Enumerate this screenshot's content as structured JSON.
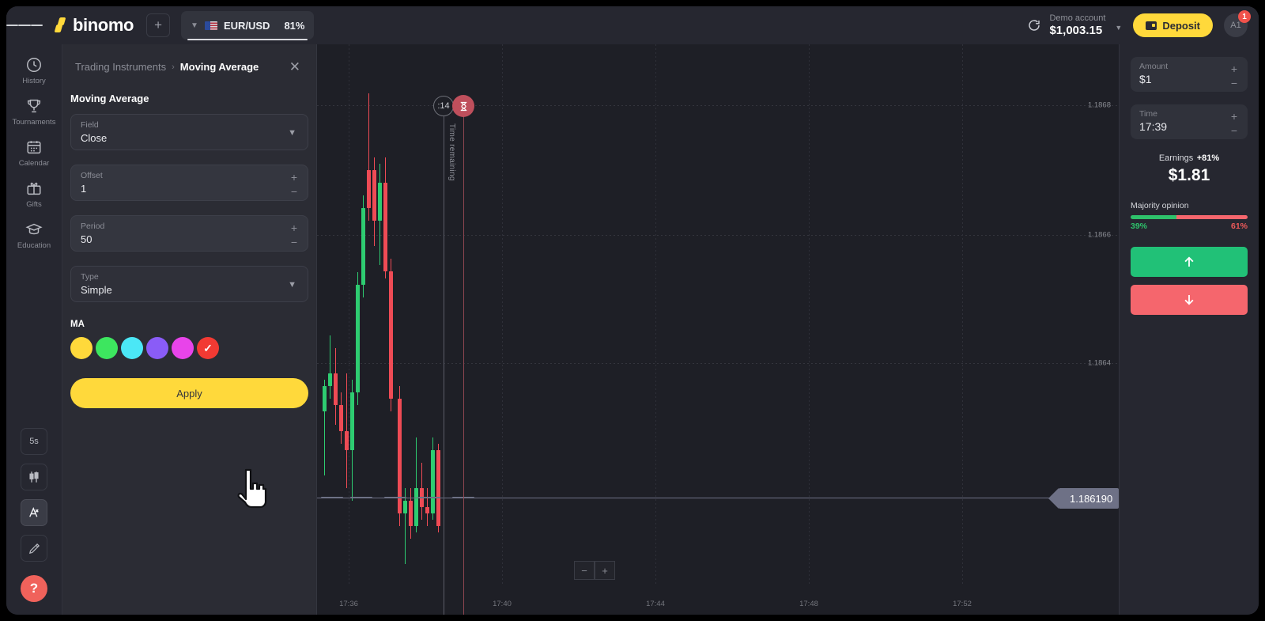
{
  "topbar": {
    "menu_icon": "hamburger-icon",
    "brand": "binomo",
    "add_label": "+",
    "asset": {
      "name": "EUR/USD",
      "payout": "81%",
      "flag": "us-eu-flag-icon",
      "chevron": "chevron-down-icon"
    },
    "refresh_icon": "refresh-icon",
    "account": {
      "label": "Demo account",
      "balance": "$1,003.15",
      "chevron": "chevron-down-icon"
    },
    "deposit_label": "Deposit",
    "wallet_icon": "wallet-icon",
    "avatar_initials": "A1",
    "avatar_badge": "1"
  },
  "rail": {
    "items": [
      {
        "label": "History",
        "icon": "clock-history-icon"
      },
      {
        "label": "Tournaments",
        "icon": "trophy-icon"
      },
      {
        "label": "Calendar",
        "icon": "calendar-icon"
      },
      {
        "label": "Gifts",
        "icon": "gift-icon"
      },
      {
        "label": "Education",
        "icon": "graduation-cap-icon"
      }
    ],
    "tools": [
      {
        "label": "5s",
        "icon": "timeframe-icon",
        "active": false
      },
      {
        "label": "",
        "icon": "candlestick-chart-icon",
        "active": false
      },
      {
        "label": "",
        "icon": "indicators-icon",
        "active": true
      },
      {
        "label": "",
        "icon": "pencil-draw-icon",
        "active": false
      }
    ],
    "help_label": "?"
  },
  "panel": {
    "breadcrumb_root": "Trading Instruments",
    "breadcrumb_sep": "›",
    "breadcrumb_current": "Moving Average",
    "close_icon": "close-icon",
    "title": "Moving Average",
    "fields": [
      {
        "label": "Field",
        "value": "Close",
        "control": "dropdown"
      },
      {
        "label": "Offset",
        "value": "1",
        "control": "stepper"
      },
      {
        "label": "Period",
        "value": "50",
        "control": "stepper"
      },
      {
        "label": "Type",
        "value": "Simple",
        "control": "dropdown"
      }
    ],
    "stepper_plus": "+",
    "stepper_minus": "−",
    "color_title": "MA",
    "colors": [
      {
        "hex": "#FFD93B",
        "selected": false
      },
      {
        "hex": "#3DE65F",
        "selected": false
      },
      {
        "hex": "#4BE7F6",
        "selected": false
      },
      {
        "hex": "#8A5CF7",
        "selected": false
      },
      {
        "hex": "#E844EA",
        "selected": false
      },
      {
        "hex": "#F23A33",
        "selected": true
      }
    ],
    "check_glyph": "✓",
    "apply_label": "Apply",
    "cursor_icon": "pointer-hand-cursor"
  },
  "chart": {
    "current_price": "1.186190",
    "timer_label": ":14",
    "timer_text": "Time remaining",
    "deal_icon": "deal-expiry-icon",
    "zoom_out": "−",
    "zoom_in": "+",
    "price_labels": [
      "1.1868",
      "1.1866",
      "1.1864"
    ],
    "time_labels": [
      "17:36",
      "17:40",
      "17:44",
      "17:48",
      "17:52"
    ]
  },
  "chart_data": {
    "type": "candlestick",
    "title": "EUR/USD",
    "xlabel": "",
    "ylabel": "",
    "ylim": [
      1.18625,
      1.18695
    ],
    "price_ticks": [
      1.1868,
      1.1866,
      1.1864
    ],
    "time_ticks": [
      "17:36",
      "17:40",
      "17:44",
      "17:48",
      "17:52"
    ],
    "current_price": 1.18619,
    "grid": true,
    "up_color": "#2ecc71",
    "down_color": "#ef4b55",
    "candles": [
      {
        "x": 400,
        "o": 1.18638,
        "h": 1.18643,
        "l": 1.18628,
        "c": 1.18642,
        "dir": "up"
      },
      {
        "x": 407,
        "o": 1.18642,
        "h": 1.1865,
        "l": 1.1864,
        "c": 1.18644,
        "dir": "up"
      },
      {
        "x": 414,
        "o": 1.18644,
        "h": 1.18648,
        "l": 1.18636,
        "c": 1.18639,
        "dir": "down"
      },
      {
        "x": 421,
        "o": 1.18639,
        "h": 1.18641,
        "l": 1.18633,
        "c": 1.18635,
        "dir": "down"
      },
      {
        "x": 428,
        "o": 1.18635,
        "h": 1.18644,
        "l": 1.18626,
        "c": 1.18632,
        "dir": "down"
      },
      {
        "x": 435,
        "o": 1.18632,
        "h": 1.18643,
        "l": 1.18624,
        "c": 1.18641,
        "dir": "up"
      },
      {
        "x": 442,
        "o": 1.18641,
        "h": 1.1866,
        "l": 1.18639,
        "c": 1.18658,
        "dir": "up"
      },
      {
        "x": 449,
        "o": 1.18658,
        "h": 1.18672,
        "l": 1.18656,
        "c": 1.1867,
        "dir": "up"
      },
      {
        "x": 456,
        "o": 1.1867,
        "h": 1.18688,
        "l": 1.18668,
        "c": 1.18676,
        "dir": "down"
      },
      {
        "x": 463,
        "o": 1.18676,
        "h": 1.18678,
        "l": 1.18664,
        "c": 1.18668,
        "dir": "down"
      },
      {
        "x": 470,
        "o": 1.18668,
        "h": 1.18677,
        "l": 1.18661,
        "c": 1.18674,
        "dir": "up"
      },
      {
        "x": 477,
        "o": 1.18674,
        "h": 1.18678,
        "l": 1.18659,
        "c": 1.1866,
        "dir": "down"
      },
      {
        "x": 484,
        "o": 1.1866,
        "h": 1.18662,
        "l": 1.18638,
        "c": 1.1864,
        "dir": "down"
      },
      {
        "x": 495,
        "o": 1.1864,
        "h": 1.18642,
        "l": 1.1862,
        "c": 1.18622,
        "dir": "down"
      },
      {
        "x": 502,
        "o": 1.18622,
        "h": 1.18626,
        "l": 1.18614,
        "c": 1.18624,
        "dir": "up"
      },
      {
        "x": 509,
        "o": 1.18624,
        "h": 1.18626,
        "l": 1.18618,
        "c": 1.1862,
        "dir": "down"
      },
      {
        "x": 516,
        "o": 1.1862,
        "h": 1.18634,
        "l": 1.18619,
        "c": 1.18626,
        "dir": "up"
      },
      {
        "x": 523,
        "o": 1.18626,
        "h": 1.1863,
        "l": 1.18621,
        "c": 1.18623,
        "dir": "down"
      },
      {
        "x": 530,
        "o": 1.18623,
        "h": 1.18626,
        "l": 1.1862,
        "c": 1.18622,
        "dir": "down"
      },
      {
        "x": 537,
        "o": 1.18622,
        "h": 1.18634,
        "l": 1.18621,
        "c": 1.18632,
        "dir": "up"
      },
      {
        "x": 544,
        "o": 1.18632,
        "h": 1.18633,
        "l": 1.18619,
        "c": 1.1862,
        "dir": "down"
      }
    ]
  },
  "trade": {
    "amount": {
      "label": "Amount",
      "value": "$1"
    },
    "time": {
      "label": "Time",
      "value": "17:39"
    },
    "stepper_plus": "+",
    "stepper_minus": "−",
    "earnings_label": "Earnings",
    "earnings_pct": "+81%",
    "earnings_amount": "$1.81",
    "majority_title": "Majority opinion",
    "majority_up": "39%",
    "majority_down": "61%",
    "majority_up_color": "#2ec26b",
    "majority_down_color": "#f5666d",
    "up_icon": "arrow-up-icon",
    "down_icon": "arrow-down-icon"
  }
}
